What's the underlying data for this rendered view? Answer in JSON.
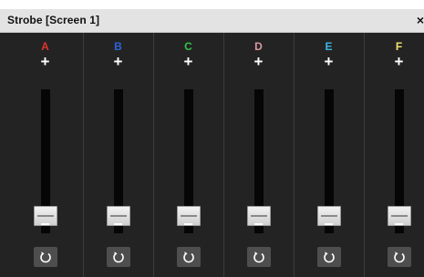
{
  "window": {
    "title": "Strobe [Screen 1]",
    "close_label": "×"
  },
  "channels": [
    {
      "name": "A",
      "color": "#e0352b",
      "increase_label": "+",
      "decrease_label": "−",
      "level": 0.12,
      "reset_icon": "reset-icon"
    },
    {
      "name": "B",
      "color": "#2e62d9",
      "increase_label": "+",
      "decrease_label": "−",
      "level": 0.12,
      "reset_icon": "reset-icon"
    },
    {
      "name": "C",
      "color": "#36c24a",
      "increase_label": "+",
      "decrease_label": "−",
      "level": 0.12,
      "reset_icon": "reset-icon"
    },
    {
      "name": "D",
      "color": "#d79aa0",
      "increase_label": "+",
      "decrease_label": "−",
      "level": 0.12,
      "reset_icon": "reset-icon"
    },
    {
      "name": "E",
      "color": "#3bb6e8",
      "increase_label": "+",
      "decrease_label": "−",
      "level": 0.12,
      "reset_icon": "reset-icon"
    },
    {
      "name": "F",
      "color": "#f3e26a",
      "increase_label": "+",
      "decrease_label": "−",
      "level": 0.12,
      "reset_icon": "reset-icon"
    }
  ]
}
